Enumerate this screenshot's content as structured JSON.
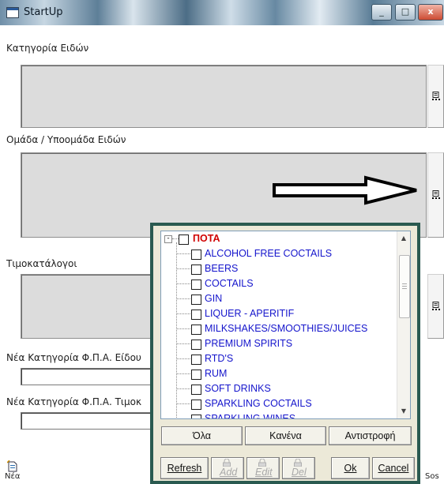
{
  "window": {
    "title": "StartUp",
    "min_label": "_",
    "max_label": "□",
    "close_label": "x"
  },
  "form": {
    "category_label": "Κατηγορία Ειδών",
    "group_label": "Ομάδα / Υποομάδα Ειδών",
    "pricelists_label": "Τιμοκατάλογοι",
    "vat_item_label": "Νέα Κατηγορία Φ.Π.Α. Είδου",
    "vat_price_label": "Νέα Κατηγορία Φ.Π.Α. Τιμοκ",
    "new_label": "Νέα",
    "sos_label": "Sos"
  },
  "popup": {
    "tree": {
      "root": "ΠΟΤΑ",
      "root_expander": "-",
      "items": [
        "ALCOHOL FREE COCTAILS",
        "BEERS",
        "COCTAILS",
        "GIN",
        "LIQUER - APERITIF",
        "MILKSHAKES/SMOOTHIES/JUICES",
        "PREMIUM SPIRITS",
        "RTD'S",
        "RUM",
        "SOFT DRINKS",
        "SPARKLING COCTAILS",
        "SPARKLING WINES"
      ]
    },
    "select_buttons": {
      "all": "Όλα",
      "none": "Κανένα",
      "invert": "Αντιστροφή"
    },
    "action_buttons": {
      "refresh": "Refresh",
      "add": "Add",
      "edit": "Edit",
      "del": "Del",
      "ok": "Ok",
      "cancel": "Cancel"
    }
  },
  "colors": {
    "root_text": "#d00000",
    "item_text": "#1515cc",
    "popup_border": "#2a5a50"
  },
  "icons": [
    "app-icon",
    "ellipsis-button-icon",
    "arrow-right-icon",
    "new-document-icon"
  ]
}
